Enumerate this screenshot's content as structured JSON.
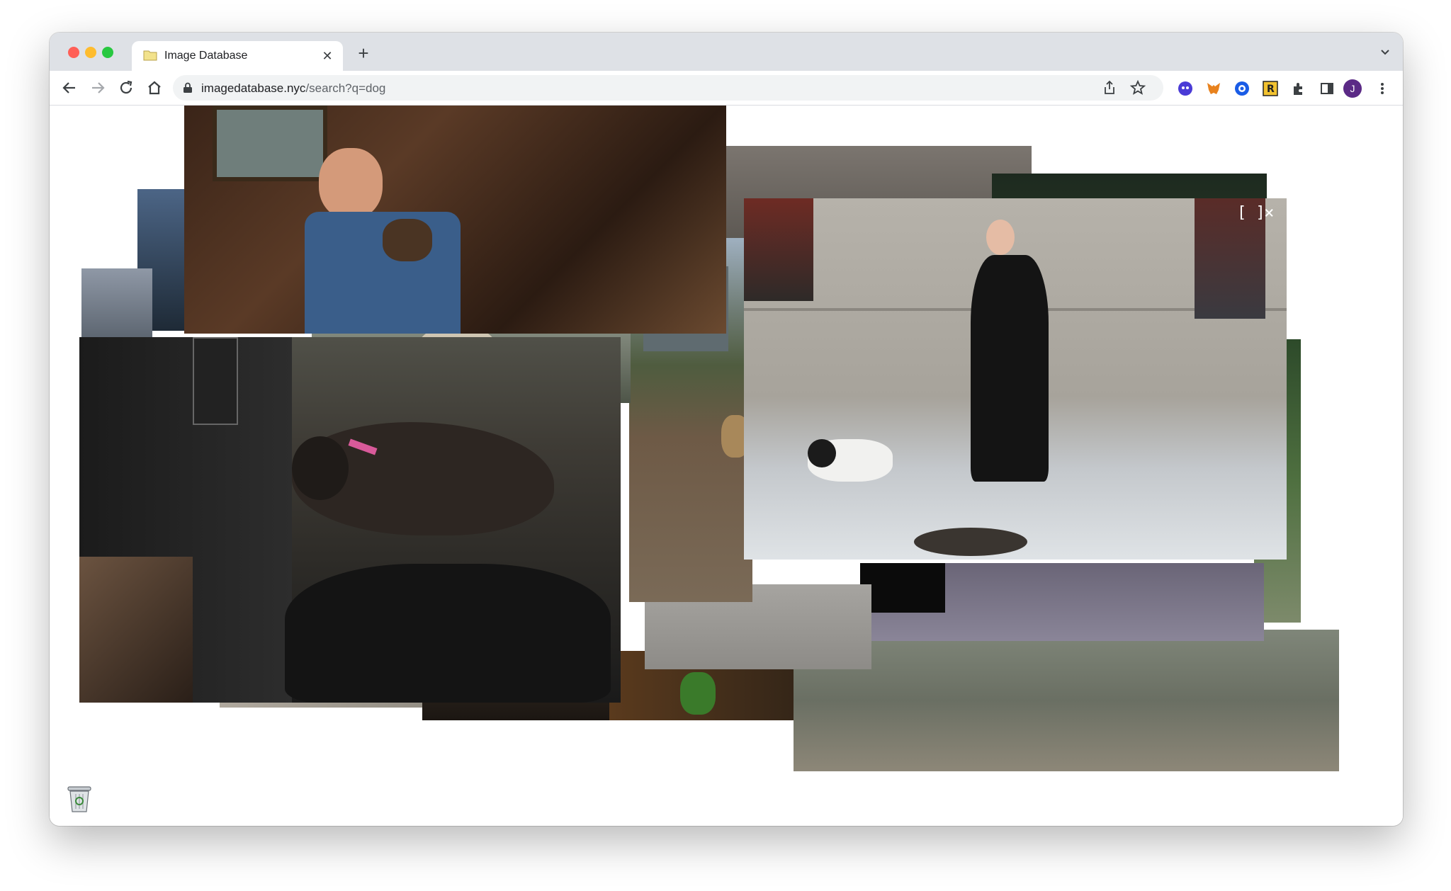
{
  "browser": {
    "tab": {
      "title": "Image Database"
    },
    "url": {
      "host": "imagedatabase.nyc",
      "path": "/search?q=dog"
    },
    "profile_initial": "J",
    "icons": [
      "back-icon",
      "forward-icon",
      "reload-icon",
      "home-icon",
      "lock-icon",
      "share-icon",
      "star-icon",
      "extension-icon",
      "sidebar-icon",
      "menu-icon"
    ]
  },
  "viewer": {
    "fullscreen_label": "[ ]",
    "close_label": "×"
  },
  "colors": {
    "chrome_tabbar": "#dee1e6",
    "omnibox": "#f1f3f4",
    "page_bg": "#ffffff"
  }
}
